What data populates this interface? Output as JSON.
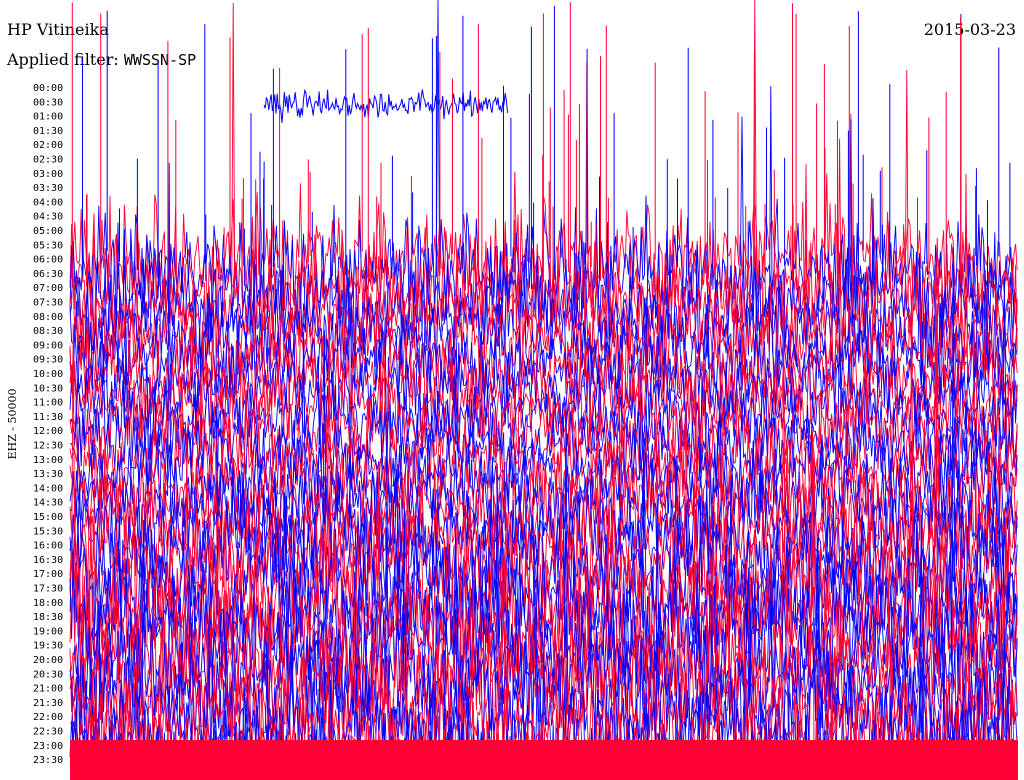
{
  "header": {
    "station": "HP Vitineika",
    "date": "2015-03-23",
    "filter_label": "Applied filter:",
    "filter_value": "WWSSN-SP"
  },
  "chart_data": {
    "type": "line",
    "title": "HP Vitineika",
    "ylabel": "EHZ - 50000",
    "ytick_labels": [
      "00:00",
      "00:30",
      "01:00",
      "01:30",
      "02:00",
      "02:30",
      "03:00",
      "03:30",
      "04:00",
      "04:30",
      "05:00",
      "05:30",
      "06:00",
      "06:30",
      "07:00",
      "07:30",
      "08:00",
      "08:30",
      "09:00",
      "09:30",
      "10:00",
      "10:30",
      "11:00",
      "11:30",
      "12:00",
      "12:30",
      "13:00",
      "13:30",
      "14:00",
      "14:30",
      "15:00",
      "15:30",
      "16:00",
      "16:30",
      "17:00",
      "17:30",
      "18:00",
      "18:30",
      "19:00",
      "19:30",
      "20:00",
      "20:30",
      "21:00",
      "21:30",
      "22:00",
      "22:30",
      "23:00",
      "23:30"
    ],
    "series": [
      {
        "color": "#0000ff",
        "active_rows": [
          1,
          47
        ]
      },
      {
        "color": "#ff0033",
        "active_rows": [
          12,
          47
        ]
      }
    ],
    "colors": {
      "trace_a": "#0000ff",
      "trace_b": "#ff0033"
    }
  }
}
